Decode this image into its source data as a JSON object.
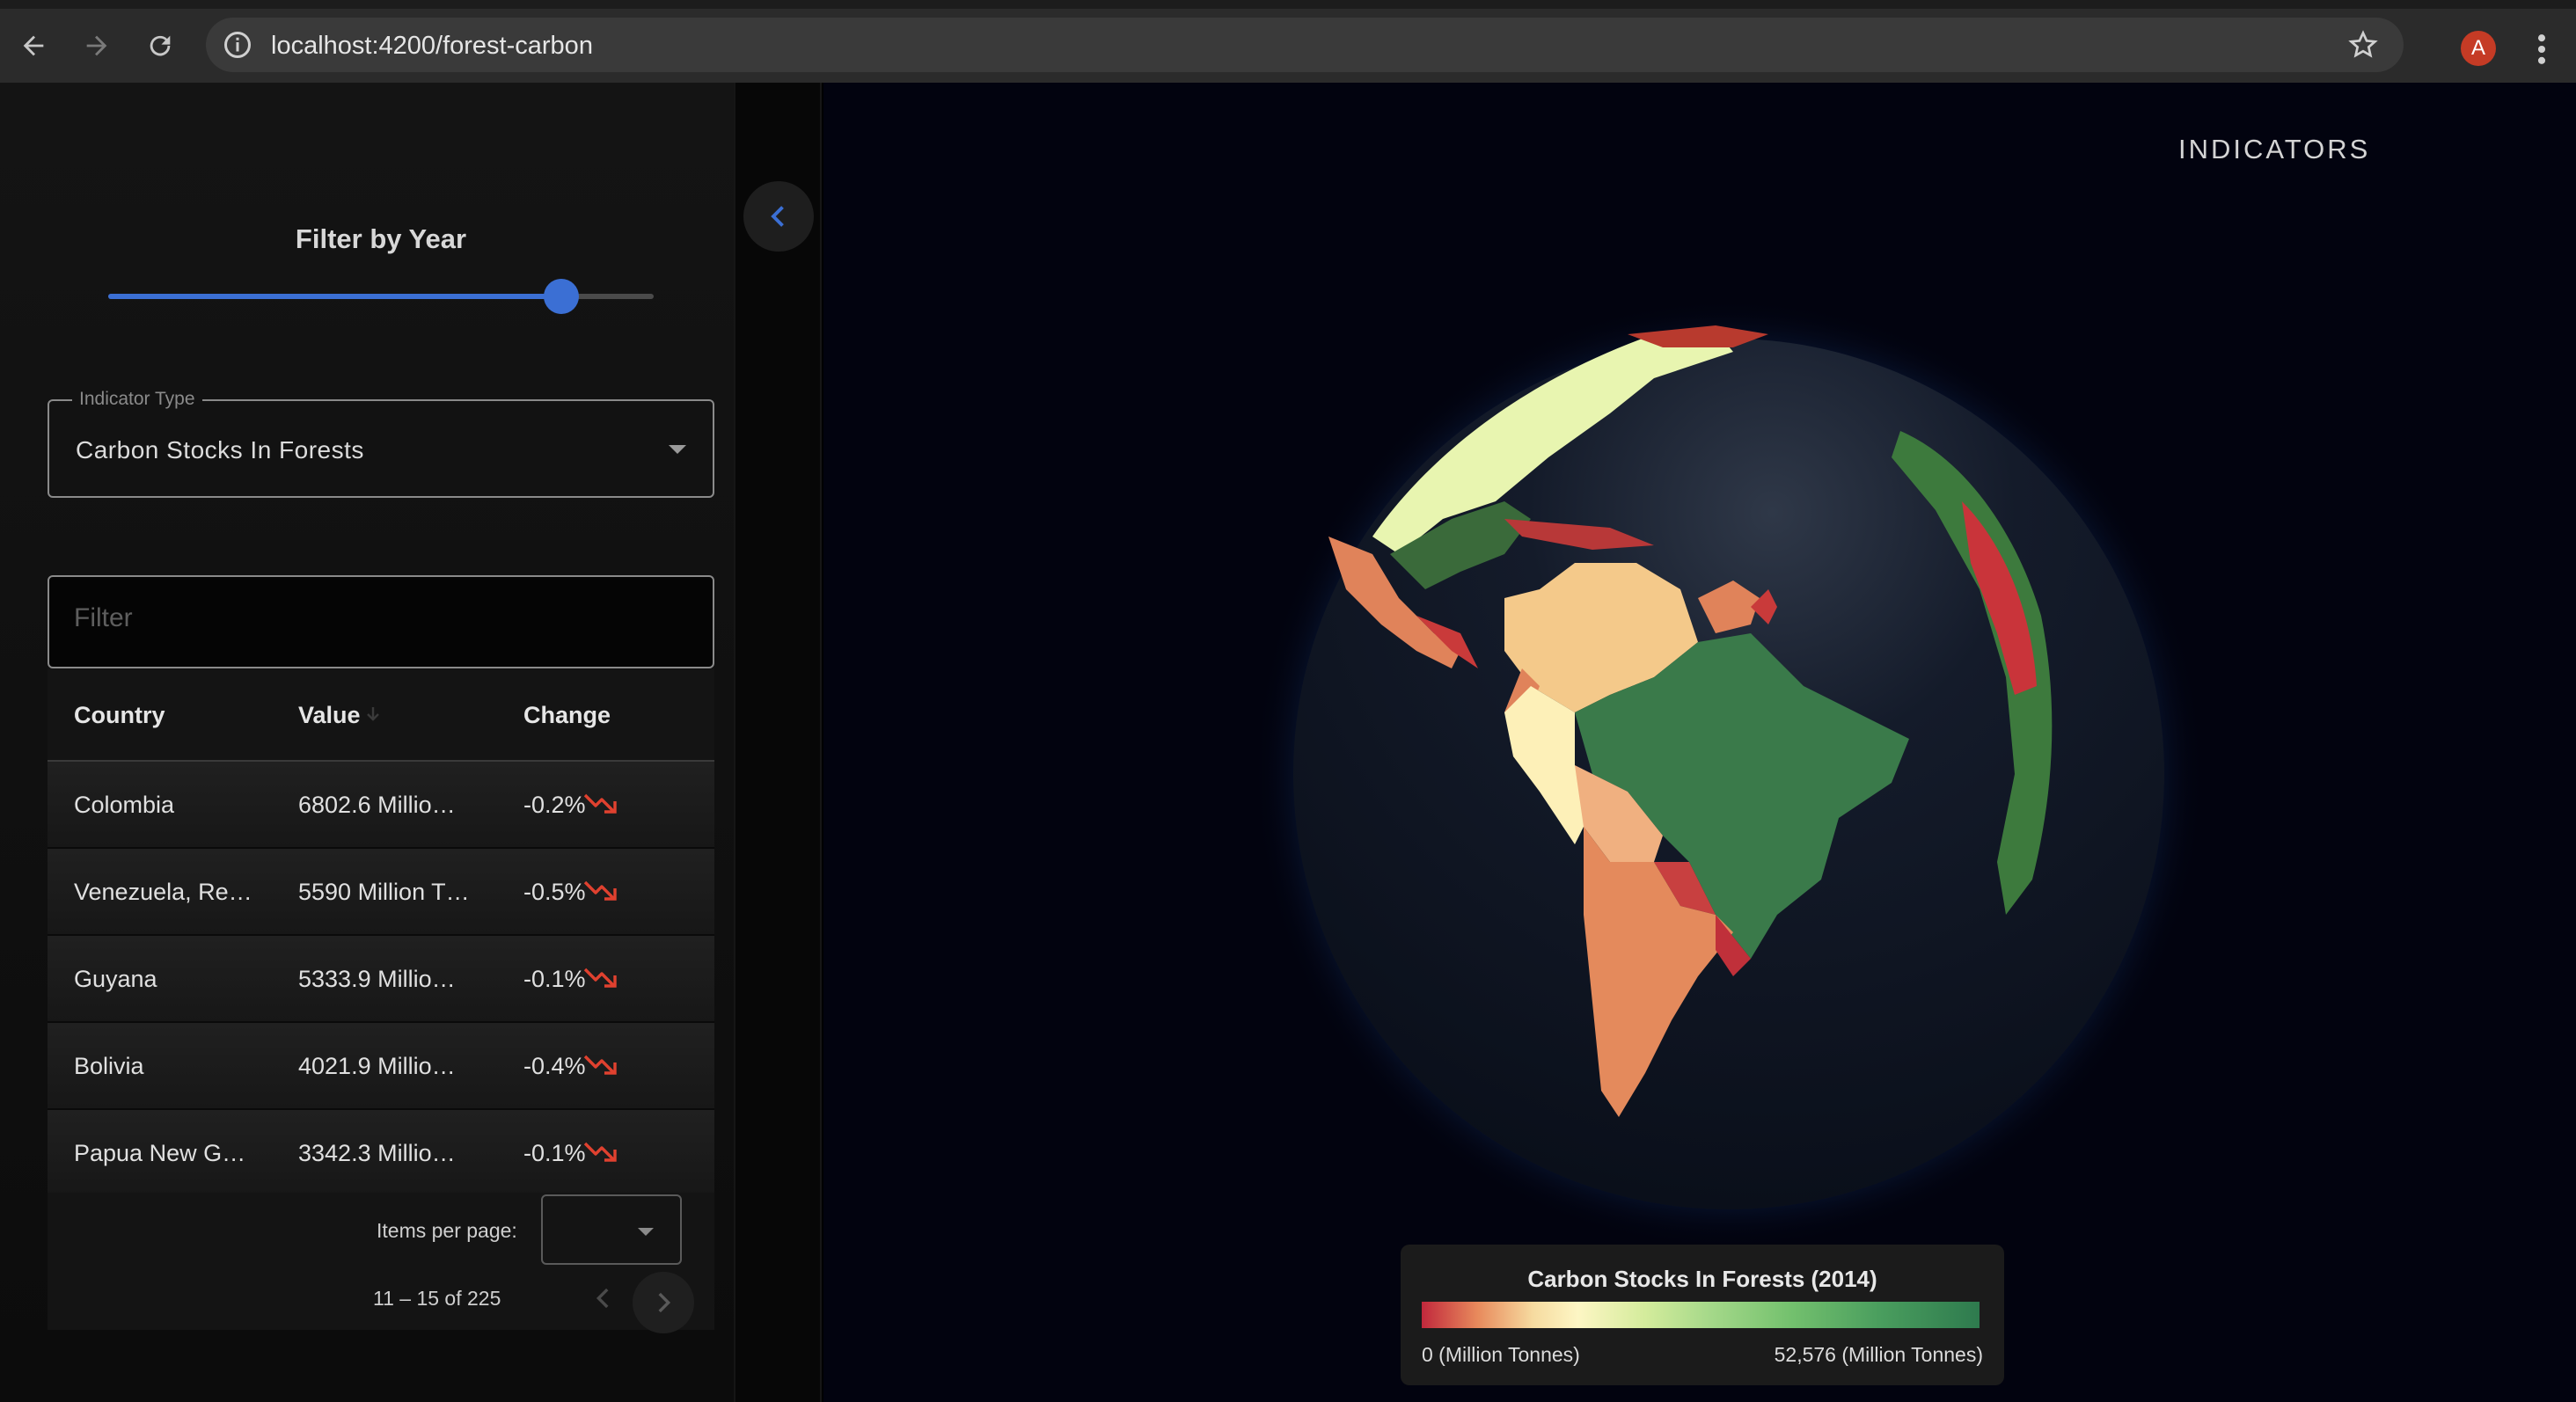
{
  "browser": {
    "url": "localhost:4200/forest-carbon",
    "avatar_letter": "A"
  },
  "sidebar": {
    "filter_year_label": "Filter by Year",
    "year_slider_fraction": 0.83,
    "indicator": {
      "label": "Indicator Type",
      "value": "Carbon Stocks In Forests"
    },
    "filter_placeholder": "Filter",
    "table": {
      "headers": {
        "country": "Country",
        "value": "Value",
        "change": "Change"
      },
      "rows": [
        {
          "country": "Colombia",
          "value": "6802.6 Millio…",
          "change": "-0.2%"
        },
        {
          "country": "Venezuela, Re…",
          "value": "5590 Million T…",
          "change": "-0.5%"
        },
        {
          "country": "Guyana",
          "value": "5333.9 Millio…",
          "change": "-0.1%"
        },
        {
          "country": "Bolivia",
          "value": "4021.9 Millio…",
          "change": "-0.4%"
        },
        {
          "country": "Papua New G…",
          "value": "3342.3 Millio…",
          "change": "-0.1%"
        }
      ]
    },
    "paginator": {
      "items_per_page_label": "Items per page:",
      "range_label": "11 – 15 of 225"
    }
  },
  "map": {
    "indicators_label": "INDICATORS",
    "legend": {
      "title": "Carbon Stocks In Forests (2014)",
      "min_label": "0 (Million Tonnes)",
      "max_label": "52,576 (Million Tonnes)"
    }
  },
  "colors": {
    "accent": "#3b6fd4",
    "trend_down": "#e0412f",
    "low": "#c1283c",
    "high": "#2e7a4e"
  }
}
